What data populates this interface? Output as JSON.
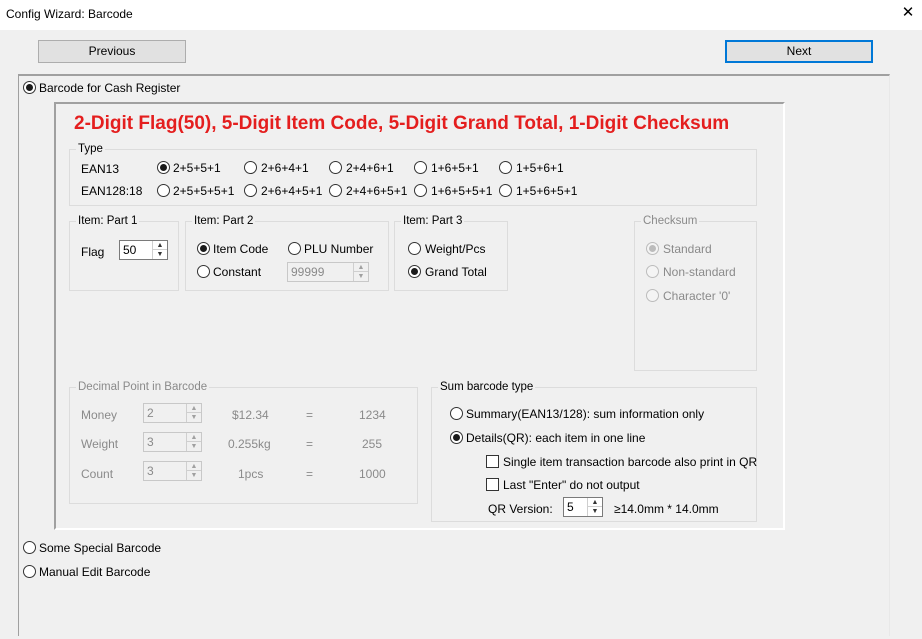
{
  "window": {
    "title": "Config Wizard: Barcode",
    "close_glyph": "✕"
  },
  "nav": {
    "previous_label": "Previous",
    "next_label": "Next"
  },
  "modes": {
    "cash_register": "Barcode for Cash Register",
    "special": "Some Special Barcode",
    "manual": "Manual Edit Barcode",
    "selected": "cash_register"
  },
  "heading": "2-Digit Flag(50), 5-Digit Item Code, 5-Digit Grand Total, 1-Digit Checksum",
  "type_group": {
    "label": "Type",
    "rows": [
      {
        "name": "EAN13",
        "options": [
          "2+5+5+1",
          "2+6+4+1",
          "2+4+6+1",
          "1+6+5+1",
          "1+5+6+1"
        ],
        "selected_index": 0
      },
      {
        "name": "EAN128:18",
        "options": [
          "2+5+5+5+1",
          "2+6+4+5+1",
          "2+4+6+5+1",
          "1+6+5+5+1",
          "1+5+6+5+1"
        ],
        "selected_index": -1
      }
    ]
  },
  "part1": {
    "label": "Item: Part 1",
    "flag_label": "Flag",
    "flag_value": "50"
  },
  "part2": {
    "label": "Item: Part 2",
    "item_code": "Item Code",
    "plu_number": "PLU Number",
    "constant": "Constant",
    "constant_value": "99999",
    "selected": "item_code"
  },
  "part3": {
    "label": "Item: Part 3",
    "weight_pcs": "Weight/Pcs",
    "grand_total": "Grand Total",
    "selected": "grand_total"
  },
  "checksum": {
    "label": "Checksum",
    "standard": "Standard",
    "non_standard": "Non-standard",
    "character0": "Character '0'",
    "selected": "standard",
    "enabled": false
  },
  "decimal_group": {
    "label": "Decimal Point in Barcode",
    "enabled": false,
    "rows": [
      {
        "name": "Money",
        "value": "2",
        "example": "$12.34",
        "eq": "=",
        "result": "1234"
      },
      {
        "name": "Weight",
        "value": "3",
        "example": "0.255kg",
        "eq": "=",
        "result": "255"
      },
      {
        "name": "Count",
        "value": "3",
        "example": "1pcs",
        "eq": "=",
        "result": "1000"
      }
    ]
  },
  "sum_group": {
    "label": "Sum barcode type",
    "summary": "Summary(EAN13/128): sum information only",
    "details": "Details(QR): each item in one line",
    "selected": "details",
    "single_item": "Single item transaction barcode also print in QR",
    "single_item_checked": false,
    "last_enter": "Last \"Enter\" do not output",
    "last_enter_checked": false,
    "qr_version_label": "QR Version:",
    "qr_version_value": "5",
    "qr_size": "≥14.0mm * 14.0mm"
  }
}
